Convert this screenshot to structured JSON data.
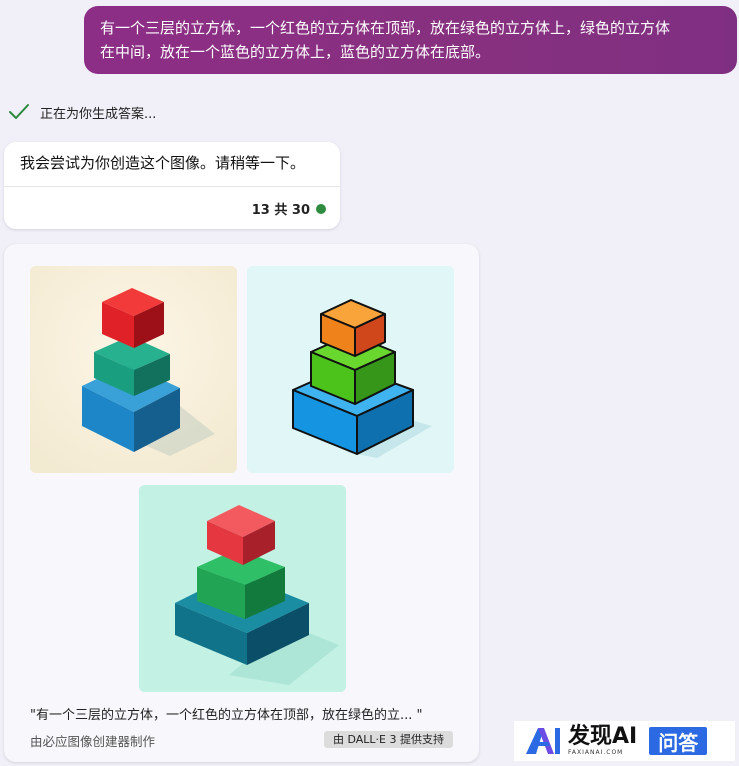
{
  "user_message": {
    "line1": "有一个三层的立方体，一个红色的立方体在顶部，放在绿色的立方体上，绿色的立方体",
    "line2": "在中间，放在一个蓝色的立方体上，蓝色的立方体在底部。"
  },
  "status": {
    "text": "正在为你生成答案...",
    "icon": "checkmark-icon"
  },
  "bot_message": {
    "text": "我会尝试为你创造这个图像。请稍等一下。",
    "count_label": "13 共 30",
    "count_dot_color": "#2e8b3f"
  },
  "image_card": {
    "images": [
      {
        "name": "generated-image-1",
        "bottom": "#1f7fc4",
        "middle": "#1ea183",
        "top": "#e2242c"
      },
      {
        "name": "generated-image-2",
        "bottom": "#1594e2",
        "middle": "#4cc31a",
        "top": "#f0821c"
      },
      {
        "name": "generated-image-3",
        "bottom": "#10738a",
        "middle": "#21a453",
        "top": "#e4373f"
      }
    ],
    "caption": "\"有一个三层的立方体，一个红色的立方体在顶部，放在绿色的立... \"",
    "creator": "由必应图像创建器制作",
    "badge": "由 DALL·E 3 提供支持"
  },
  "watermark": {
    "brand": "发现AI",
    "brand_sub": "FAXIANAI.COM",
    "tag": "问答"
  },
  "colors": {
    "page_bg": "#f1eff7",
    "user_bubble": "#8a2f82",
    "brand_blue": "#2b6ae3"
  }
}
